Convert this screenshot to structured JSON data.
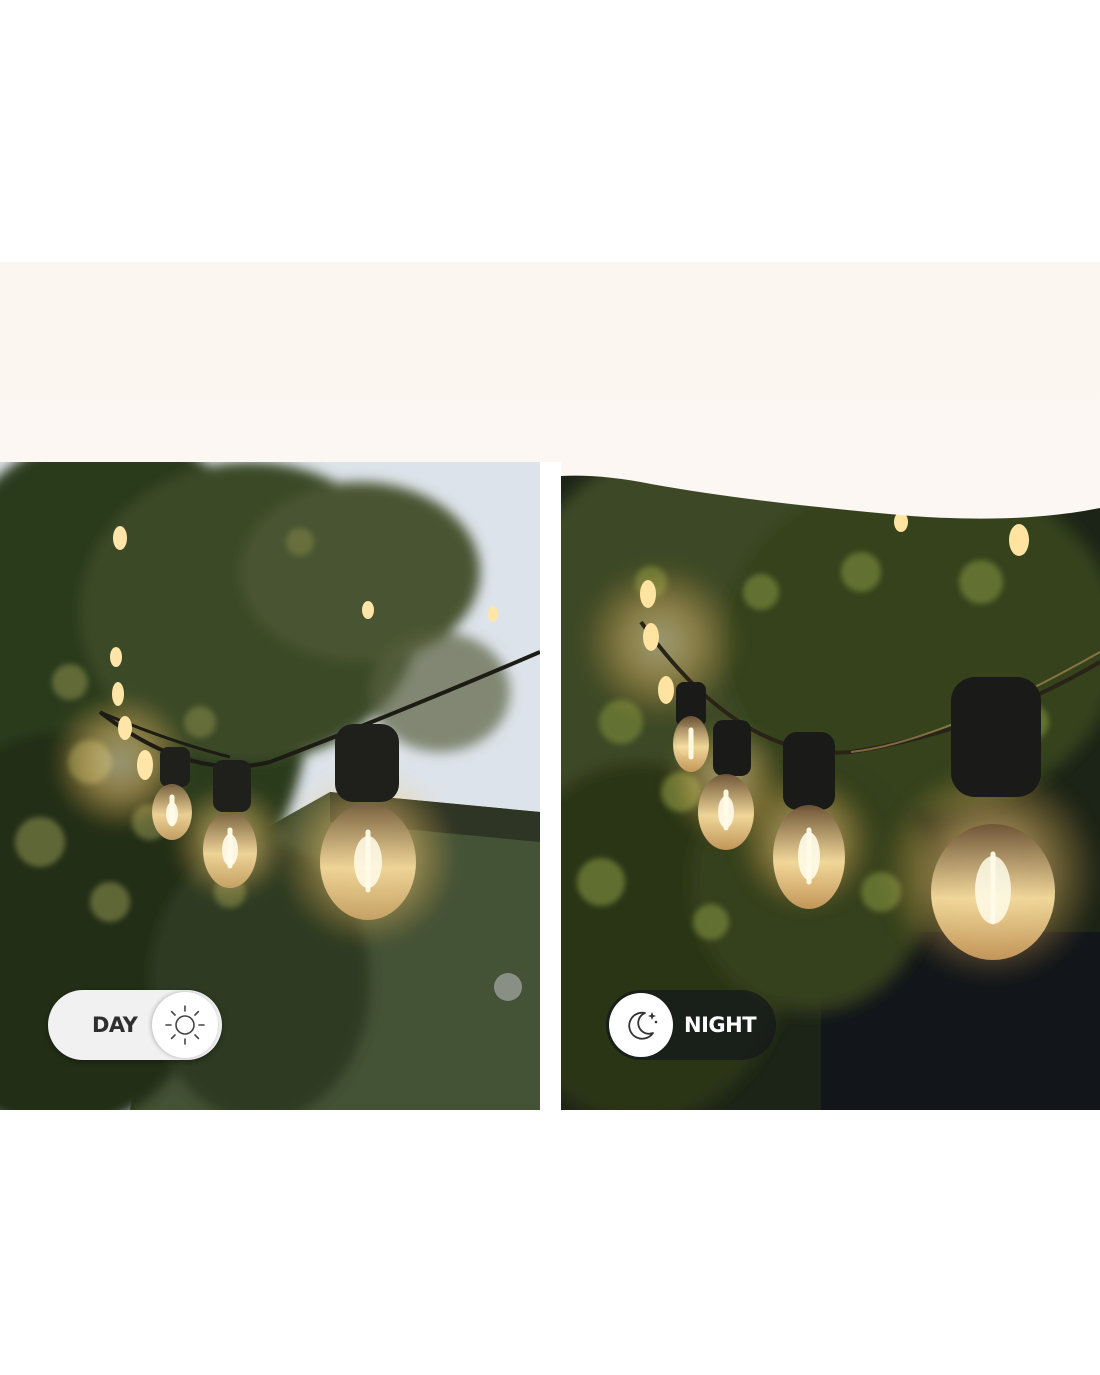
{
  "day_toggle": {
    "label": "DAY",
    "icon": "sun-icon",
    "state": "off"
  },
  "night_toggle": {
    "label": "NIGHT",
    "icon": "moon-icon",
    "state": "on"
  },
  "colors": {
    "band": "#fbf6f0",
    "bulb_glow": "#ffd98a",
    "day_sky": "#dfe4ea",
    "night_bg": "#1d2418"
  }
}
